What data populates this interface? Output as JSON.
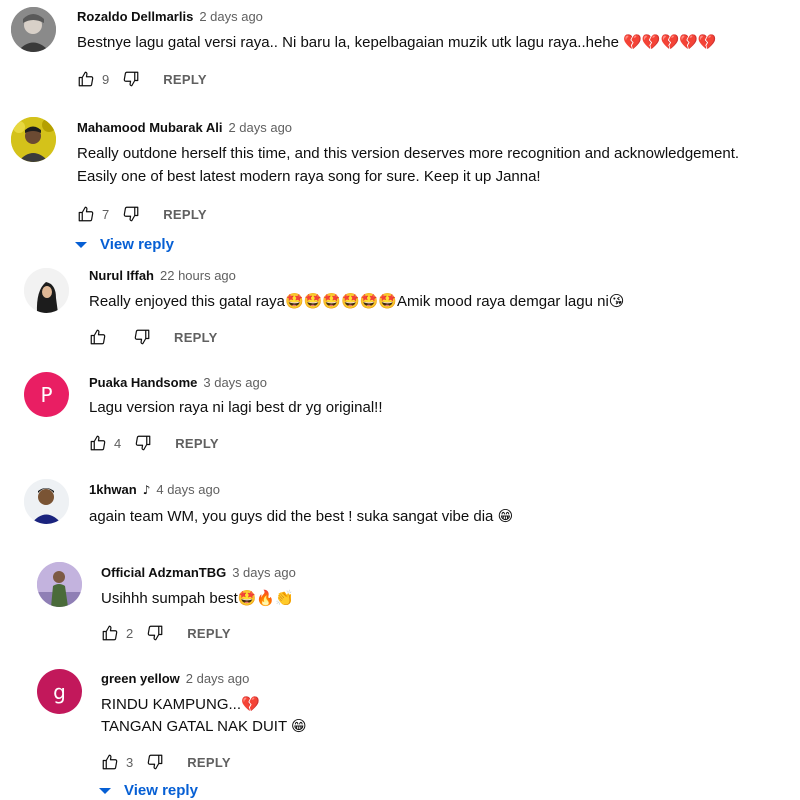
{
  "comments": [
    {
      "author": "Rozaldo Dellmarlis",
      "time": "2 days ago",
      "lines": [
        "Bestnye lagu gatal versi raya.. Ni baru la, kepelbagaian muzik utk lagu raya..hehe"
      ],
      "emoji_tail": "💔💔💔💔💔",
      "likes": "9",
      "reply_label": "REPLY"
    },
    {
      "author": "Mahamood Mubarak Ali",
      "time": "2 days ago",
      "lines": [
        "Really outdone herself this time, and this version deserves more recognition and acknowledgement.",
        "Easily one of best latest modern raya song for sure. Keep it up Janna!"
      ],
      "likes": "7",
      "reply_label": "REPLY",
      "view_reply": "View reply"
    },
    {
      "author": "Nurul Iffah",
      "time": "22 hours ago",
      "text_a": "Really enjoyed this gatal raya",
      "emoji_a": "🤩🤩🤩🤩🤩🤩",
      "text_b": "Amik mood raya demgar lagu ni",
      "emoji_b": "😘",
      "likes": "",
      "reply_label": "REPLY"
    },
    {
      "author": "Puaka Handsome",
      "time": "3 days ago",
      "avatar_letter": "P",
      "avatar_color": "#e91e63",
      "lines": [
        "Lagu version raya ni lagi best dr yg original!!"
      ],
      "likes": "4",
      "reply_label": "REPLY"
    },
    {
      "author": "1khwan",
      "author_icon": "music-note-icon",
      "time": "4 days ago",
      "text_a": "again team WM, you guys did the best ! suka sangat vibe dia ",
      "emoji_a": "😁"
    },
    {
      "author": "Official AdzmanTBG",
      "time": "3 days ago",
      "text_a": "Usihhh sumpah best",
      "emoji_a": "🤩🔥👏",
      "likes": "2",
      "reply_label": "REPLY"
    },
    {
      "author": "green yellow",
      "time": "2 days ago",
      "avatar_letter": "g",
      "avatar_color": "#c2185b",
      "line1": "RINDU KAMPUNG...",
      "emoji1": "💔",
      "line2": "TANGAN GATAL NAK DUIT ",
      "emoji2": "😁",
      "likes": "3",
      "reply_label": "REPLY",
      "view_reply": "View reply"
    }
  ],
  "colors": {
    "link": "#065fd4",
    "muted": "#606060",
    "text": "#0f0f0f"
  }
}
